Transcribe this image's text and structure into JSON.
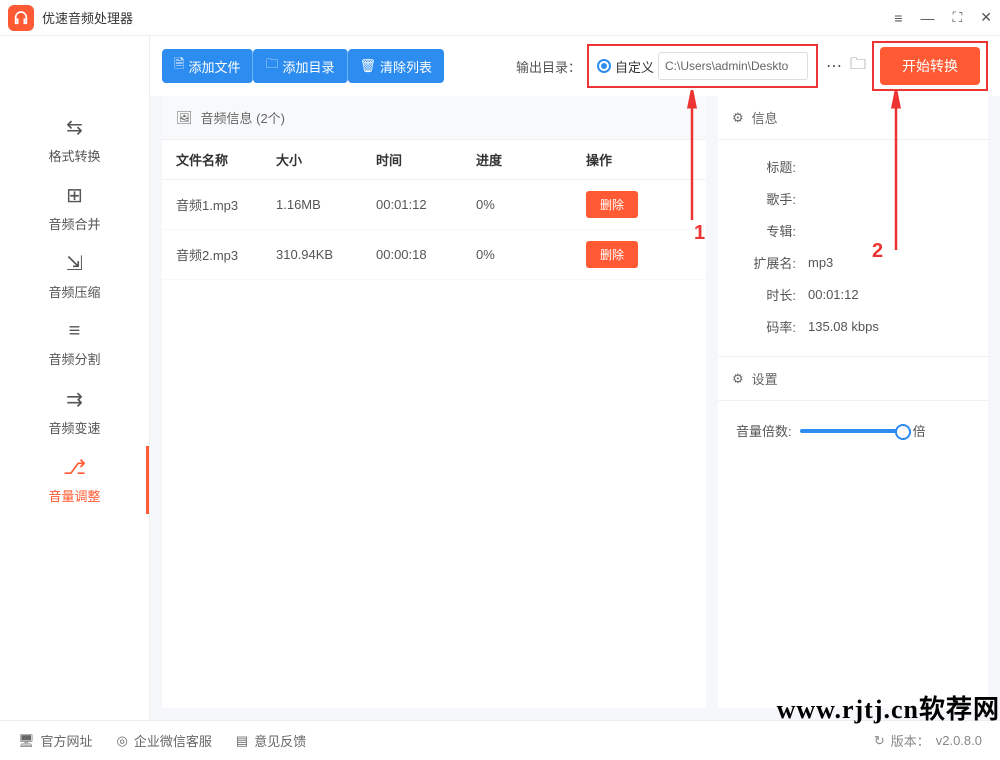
{
  "window": {
    "title": "优速音频处理器"
  },
  "sidebar": {
    "items": [
      {
        "label": "格式转换",
        "icon": "⇆"
      },
      {
        "label": "音频合并",
        "icon": "⊞"
      },
      {
        "label": "音频压缩",
        "icon": "⇲"
      },
      {
        "label": "音频分割",
        "icon": "≡"
      },
      {
        "label": "音频变速",
        "icon": "⇉"
      },
      {
        "label": "音量调整",
        "icon": "⎇"
      }
    ]
  },
  "toolbar": {
    "add_file": "添加文件",
    "add_folder": "添加目录",
    "clear_list": "清除列表",
    "output_label": "输出目录：",
    "custom_label": "自定义",
    "path": "C:\\Users\\admin\\Deskto",
    "start": "开始转换"
  },
  "table": {
    "header_label": "音频信息 (2个)",
    "columns": {
      "name": "文件名称",
      "size": "大小",
      "time": "时间",
      "progress": "进度",
      "action": "操作"
    },
    "rows": [
      {
        "name": "音频1.mp3",
        "size": "1.16MB",
        "time": "00:01:12",
        "progress": "0%",
        "action": "删除"
      },
      {
        "name": "音频2.mp3",
        "size": "310.94KB",
        "time": "00:00:18",
        "progress": "0%",
        "action": "删除"
      }
    ]
  },
  "info": {
    "header": "信息",
    "fields": {
      "title_k": "标题:",
      "title_v": "",
      "artist_k": "歌手:",
      "artist_v": "",
      "album_k": "专辑:",
      "album_v": "",
      "ext_k": "扩展名:",
      "ext_v": "mp3",
      "duration_k": "时长:",
      "duration_v": "00:01:12",
      "bitrate_k": "码率:",
      "bitrate_v": "135.08 kbps"
    }
  },
  "settings": {
    "header": "设置",
    "volume_label": "音量倍数:",
    "volume_unit": "倍"
  },
  "footer": {
    "link1": "官方网址",
    "link2": "企业微信客服",
    "link3": "意见反馈",
    "version_label": "版本：",
    "version": "v2.0.8.0"
  },
  "watermark": "www.rjtj.cn软荐网",
  "annotations": {
    "a1": "1",
    "a2": "2"
  }
}
